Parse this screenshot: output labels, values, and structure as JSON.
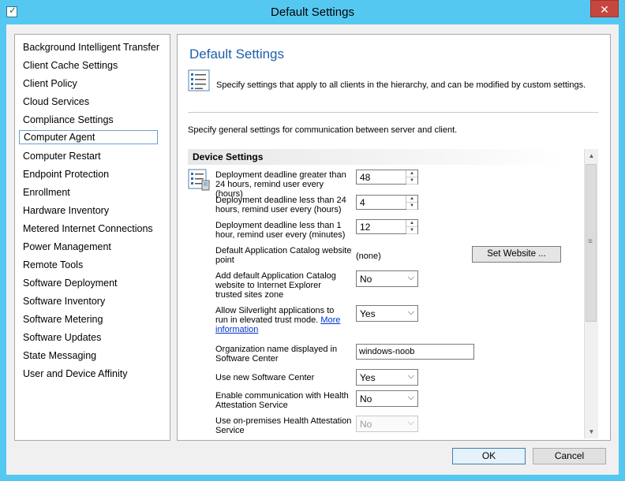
{
  "window": {
    "title": "Default Settings",
    "close_label": "✕"
  },
  "nav": {
    "items": [
      {
        "label": "Background Intelligent Transfer",
        "selected": false
      },
      {
        "label": "Client Cache Settings",
        "selected": false
      },
      {
        "label": "Client Policy",
        "selected": false
      },
      {
        "label": "Cloud Services",
        "selected": false
      },
      {
        "label": "Compliance Settings",
        "selected": false
      },
      {
        "label": "Computer Agent",
        "selected": true
      },
      {
        "label": "Computer Restart",
        "selected": false
      },
      {
        "label": "Endpoint Protection",
        "selected": false
      },
      {
        "label": "Enrollment",
        "selected": false
      },
      {
        "label": "Hardware Inventory",
        "selected": false
      },
      {
        "label": "Metered Internet Connections",
        "selected": false
      },
      {
        "label": "Power Management",
        "selected": false
      },
      {
        "label": "Remote Tools",
        "selected": false
      },
      {
        "label": "Software Deployment",
        "selected": false
      },
      {
        "label": "Software Inventory",
        "selected": false
      },
      {
        "label": "Software Metering",
        "selected": false
      },
      {
        "label": "Software Updates",
        "selected": false
      },
      {
        "label": "State Messaging",
        "selected": false
      },
      {
        "label": "User and Device Affinity",
        "selected": false
      }
    ]
  },
  "content": {
    "title": "Default Settings",
    "description": "Specify settings that apply to all clients in the hierarchy, and can be modified by custom settings.",
    "general": "Specify general settings for communication between server and client.",
    "group_title": "Device Settings"
  },
  "settings": {
    "deadline_gt24": {
      "label": "Deployment deadline greater than 24 hours, remind user every (hours)",
      "value": "48"
    },
    "deadline_lt24": {
      "label": "Deployment deadline less than 24 hours, remind user every (hours)",
      "value": "4"
    },
    "deadline_lt1": {
      "label": "Deployment deadline less than 1 hour, remind user every (minutes)",
      "value": "12"
    },
    "catalog_point": {
      "label": "Default Application Catalog website point",
      "value": "(none)",
      "button": "Set Website ..."
    },
    "add_catalog_ie": {
      "label": "Add default Application Catalog website to Internet Explorer trusted sites zone",
      "value": "No"
    },
    "silverlight": {
      "label": "Allow Silverlight applications to run in elevated trust mode.",
      "link": "More information",
      "value": "Yes"
    },
    "org_name": {
      "label": "Organization name displayed in Software Center",
      "value": "windows-noob"
    },
    "new_sc": {
      "label": "Use new Software Center",
      "value": "Yes"
    },
    "health_attest": {
      "label": "Enable communication with Health Attestation Service",
      "value": "No"
    },
    "onprem_health": {
      "label": "Use on-premises Health Attestation Service",
      "value": "No"
    }
  },
  "footer": {
    "ok": "OK",
    "cancel": "Cancel"
  },
  "icons": {
    "app": "checklist-icon",
    "settings": "settings-list-icon",
    "agent": "computer-agent-icon"
  },
  "colors": {
    "titlebar": "#55c8f2",
    "title_text": "#1e5fa8",
    "close": "#c7463f",
    "link": "#0033cc"
  }
}
